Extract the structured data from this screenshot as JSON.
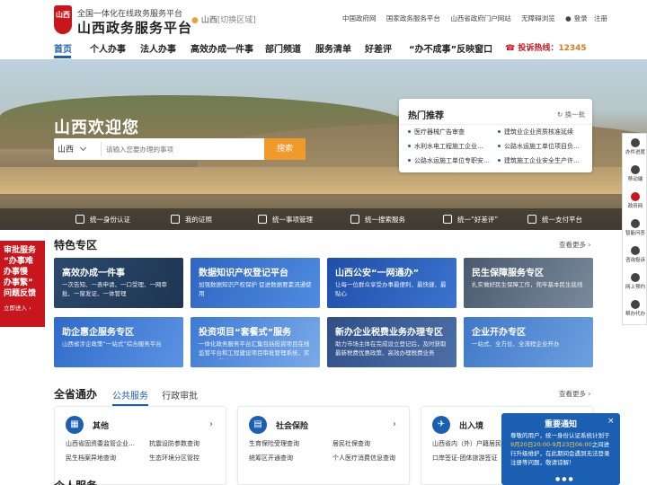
{
  "header": {
    "badge": "山西",
    "subtitle": "全国一体化在线政务服务平台",
    "title": "山西政务服务平台",
    "location": "山西",
    "switch_label": "[切换区域]",
    "links": [
      "中国政府网",
      "国家政务服务平台",
      "山西省政府门户网站",
      "无障碍浏览",
      "登录",
      "注册"
    ]
  },
  "nav": {
    "items": [
      "首页",
      "个人办事",
      "法人办事",
      "高效办成一件事",
      "部门频道",
      "服务清单",
      "好差评",
      "“办不成事”反映窗口"
    ],
    "hotline_label": "投诉热线：",
    "hotline_number": "12345"
  },
  "hero": {
    "title": "山西欢迎您",
    "search_region": "山西",
    "search_placeholder": "请输入您要办理的事项",
    "search_button": "搜索"
  },
  "hot": {
    "title": "热门推荐",
    "change": "换一批",
    "items": [
      "医疗器械广告审查",
      "建筑业企业资质核准延续",
      "水利水电工程施工企业…",
      "公路水运施工单位项目负…",
      "公路水运施工单位专职安…",
      "建筑施工企业安全生产许…"
    ]
  },
  "quick": [
    "统一身份认证",
    "我的证照",
    "统一事项管理",
    "统一搜索服务",
    "统一“好差评”",
    "统一支付平台"
  ],
  "featured": {
    "title": "特色专区",
    "more": "查看更多 ›",
    "cards": [
      {
        "title": "高效办成一件事",
        "desc": "一次告知、一表申请、一口受理、一网审批、一窗发证、一体管理"
      },
      {
        "title": "数据知识产权登记平台",
        "desc": "加强数据知识产权保护 促进数据要素流通使用"
      },
      {
        "title": "山西公安“一网通办”",
        "desc": "让每一位群众享受办事最便利、最快捷、最贴心"
      },
      {
        "title": "民生保障服务专区",
        "desc": "扎实做好民生保障工作，兜牢基本民生底线"
      },
      {
        "title": "助企惠企服务专区",
        "desc": "山西省涉企政策“一站式”综合服务平台"
      },
      {
        "title": "投资项目“套餐式”服务",
        "desc": "一体化政务服务平台汇集包括投资项目在线监管平台和工程建设项目审批管理系统，实现“三网融合”"
      },
      {
        "title": "新办企业税费业务办理专区",
        "desc": "助力市场主体在完成设立登记后，及时获取最新税费优惠政策、高效办理税费业务"
      },
      {
        "title": "企业开办专区",
        "desc": "一站式、全方位、全流程企业开办"
      }
    ]
  },
  "province": {
    "title": "全省通办",
    "tab_active": "公共服务",
    "tab_other": "行政审批",
    "more": "查看更多 ›",
    "cards": [
      {
        "name": "其他",
        "icon": "▦",
        "links": [
          "山西省固资委监管企业…",
          "抗震设防参数查询",
          "民生档案异地查询",
          "生态环境分区管控"
        ]
      },
      {
        "name": "社会保险",
        "icon": "▤",
        "links": [
          "生育保险受理查询",
          "居民社保查询",
          "统筹区开通查询",
          "个人医疗消费信息查询"
        ]
      },
      {
        "name": "出入境",
        "icon": "✈",
        "links": [
          "山西省内（外）户籍居民…",
          "",
          "口岸签证-团体旅游签证",
          ""
        ]
      }
    ]
  },
  "partial_title": "个人服务",
  "promo": {
    "lines": [
      "审批服务",
      "“办事难",
      "办事慢",
      "办事繁”",
      "问题反馈"
    ],
    "link": "立即进入 ›"
  },
  "tools": [
    "办件进度",
    "移动端",
    "政府网",
    "智能问答",
    "咨询投诉",
    "网上预约",
    "帮办代办"
  ],
  "notice": {
    "title": "重要通知",
    "close": "×",
    "body_pre": "尊敬的用户，统一身份认证系统计划于",
    "body_hl": "9月20日20:00-9月23日06:00",
    "body_post": "之间进行升级维护，在此期间会遇到无法登录注册等问题，敬请谅解！",
    "dots": "●●●"
  }
}
